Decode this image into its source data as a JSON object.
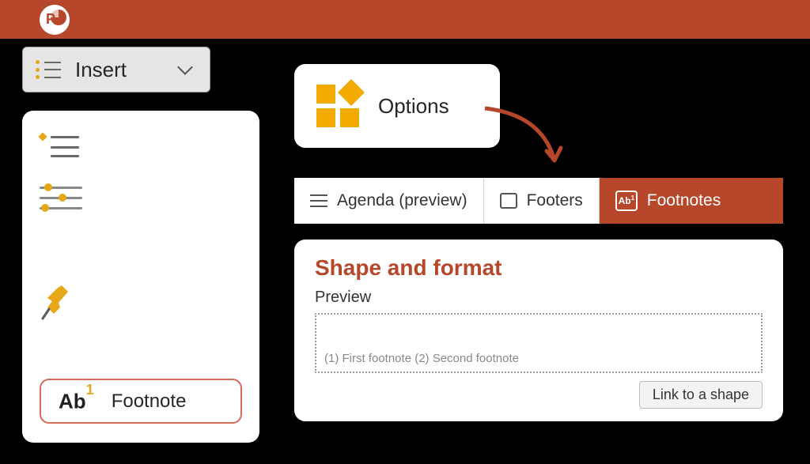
{
  "app": {
    "name": "PowerPoint"
  },
  "insert": {
    "label": "Insert",
    "footnote_label": "Footnote"
  },
  "options": {
    "label": "Options"
  },
  "tabs": {
    "agenda": "Agenda (preview)",
    "footers": "Footers",
    "footnotes": "Footnotes"
  },
  "shape_panel": {
    "title": "Shape and format",
    "preview_label": "Preview",
    "preview_text": "(1) First footnote (2) Second footnote",
    "link_button": "Link to a shape"
  }
}
